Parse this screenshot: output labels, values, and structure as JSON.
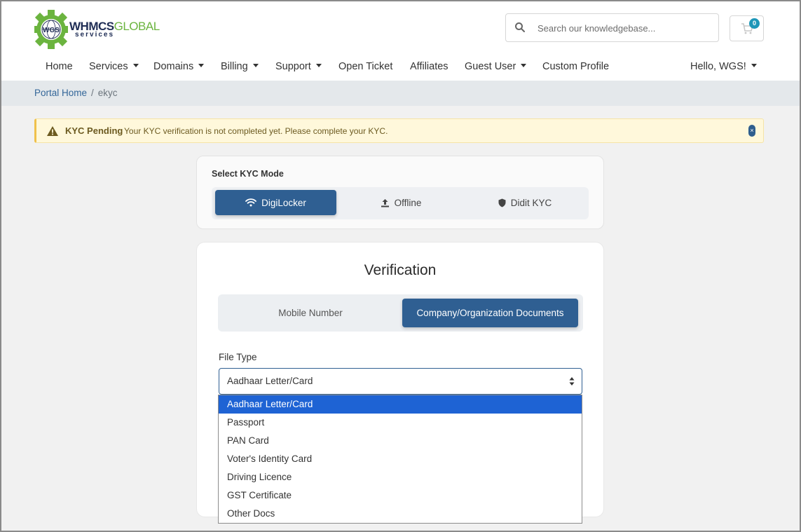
{
  "brand": {
    "logo_main": "WHMCS",
    "logo_accent": "GLOBAL",
    "logo_sub": "services",
    "logo_badge": "WGS",
    "green": "#6bb43f",
    "navy": "#1f2d55"
  },
  "search": {
    "placeholder": "Search our knowledgebase..."
  },
  "cart": {
    "count": "0"
  },
  "nav": {
    "home": "Home",
    "services": "Services",
    "domains": "Domains",
    "billing": "Billing",
    "support": "Support",
    "open_ticket": "Open Ticket",
    "affiliates": "Affiliates",
    "guest_user": "Guest User",
    "custom_profile": "Custom Profile",
    "hello": "Hello, WGS!"
  },
  "breadcrumb": {
    "home": "Portal Home",
    "separator": "/",
    "current": "ekyc"
  },
  "alert": {
    "title": "KYC Pending",
    "message": "Your KYC verification is not completed yet. Please complete your KYC.",
    "close": "×"
  },
  "kyc_mode": {
    "label": "Select KYC Mode",
    "tabs": [
      "DigiLocker",
      "Offline",
      "Didit KYC"
    ],
    "active_index": 0
  },
  "verification": {
    "title": "Verification",
    "tabs": [
      "Mobile Number",
      "Company/Organization Documents"
    ],
    "active_index": 1,
    "file_type_label": "File Type",
    "selected_value": "Aadhaar Letter/Card",
    "options": [
      "Aadhaar Letter/Card",
      "Passport",
      "PAN Card",
      "Voter's Identity Card",
      "Driving Licence",
      "GST Certificate",
      "Other Docs"
    ],
    "highlighted_index": 0
  },
  "colors": {
    "primary": "#2f5f92",
    "alert_bg": "#fff8db",
    "option_highlight": "#1e63d4",
    "badge": "#1d96b8"
  }
}
